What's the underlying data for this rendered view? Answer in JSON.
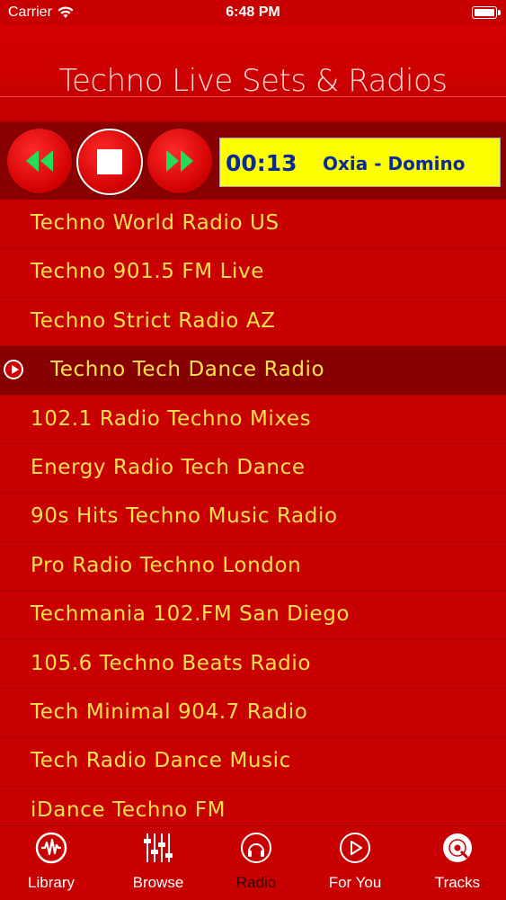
{
  "status": {
    "carrier": "Carrier",
    "time": "6:48 PM"
  },
  "header": {
    "title": "Techno Live Sets & Radios"
  },
  "player": {
    "timer": "00:13",
    "track": "Oxia - Domino"
  },
  "stations": [
    {
      "label": "Techno World Radio US"
    },
    {
      "label": "Techno 901.5 FM Live"
    },
    {
      "label": "Techno Strict Radio AZ"
    },
    {
      "label": "Techno Tech Dance Radio"
    },
    {
      "label": "102.1 Radio Techno Mixes"
    },
    {
      "label": "Energy Radio Tech Dance"
    },
    {
      "label": "90s Hits Techno Music Radio"
    },
    {
      "label": "Pro Radio Techno London"
    },
    {
      "label": "Techmania 102.FM San Diego"
    },
    {
      "label": "105.6 Techno Beats Radio"
    },
    {
      "label": "Tech Minimal 904.7 Radio"
    },
    {
      "label": "Tech Radio Dance Music"
    },
    {
      "label": "iDance Techno FM"
    }
  ],
  "active_station": "Techno Tech Dance Radio",
  "tabs": [
    {
      "label": "Library",
      "icon": "library-icon"
    },
    {
      "label": "Browse",
      "icon": "sliders-icon"
    },
    {
      "label": "Radio",
      "icon": "headphones-icon"
    },
    {
      "label": "For You",
      "icon": "play-circle-icon"
    },
    {
      "label": "Tracks",
      "icon": "record-icon"
    }
  ],
  "selected_tab": "Radio",
  "colors": {
    "background": "#c90000",
    "station_text": "#ffe14d",
    "now_playing_bg": "#ffff00",
    "now_playing_text": "#0a2a9a",
    "active_row": "#870000",
    "control_arrows": "#22dd55"
  }
}
